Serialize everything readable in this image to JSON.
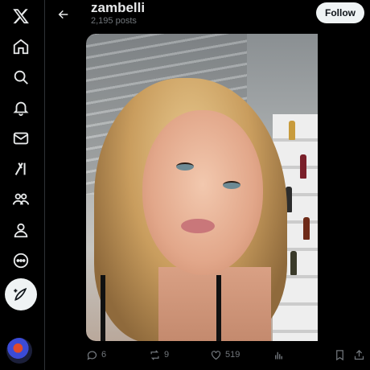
{
  "profile": {
    "name": "zambelli",
    "posts_count": "2,195 posts",
    "follow_label": "Follow"
  },
  "post": {
    "replies": "6",
    "reposts": "9",
    "likes": "519"
  },
  "icons": {
    "logo": "x-logo-icon",
    "nav": [
      "home-icon",
      "explore-icon",
      "notifications-icon",
      "messages-icon",
      "grok-icon",
      "communities-icon",
      "profile-icon",
      "more-icon"
    ],
    "compose": "compose-post-icon"
  },
  "colors": {
    "background": "#000000",
    "text_primary": "#e7e9ea",
    "text_secondary": "#71767b",
    "follow_bg": "#eff3f4",
    "divider": "#2f3336"
  }
}
